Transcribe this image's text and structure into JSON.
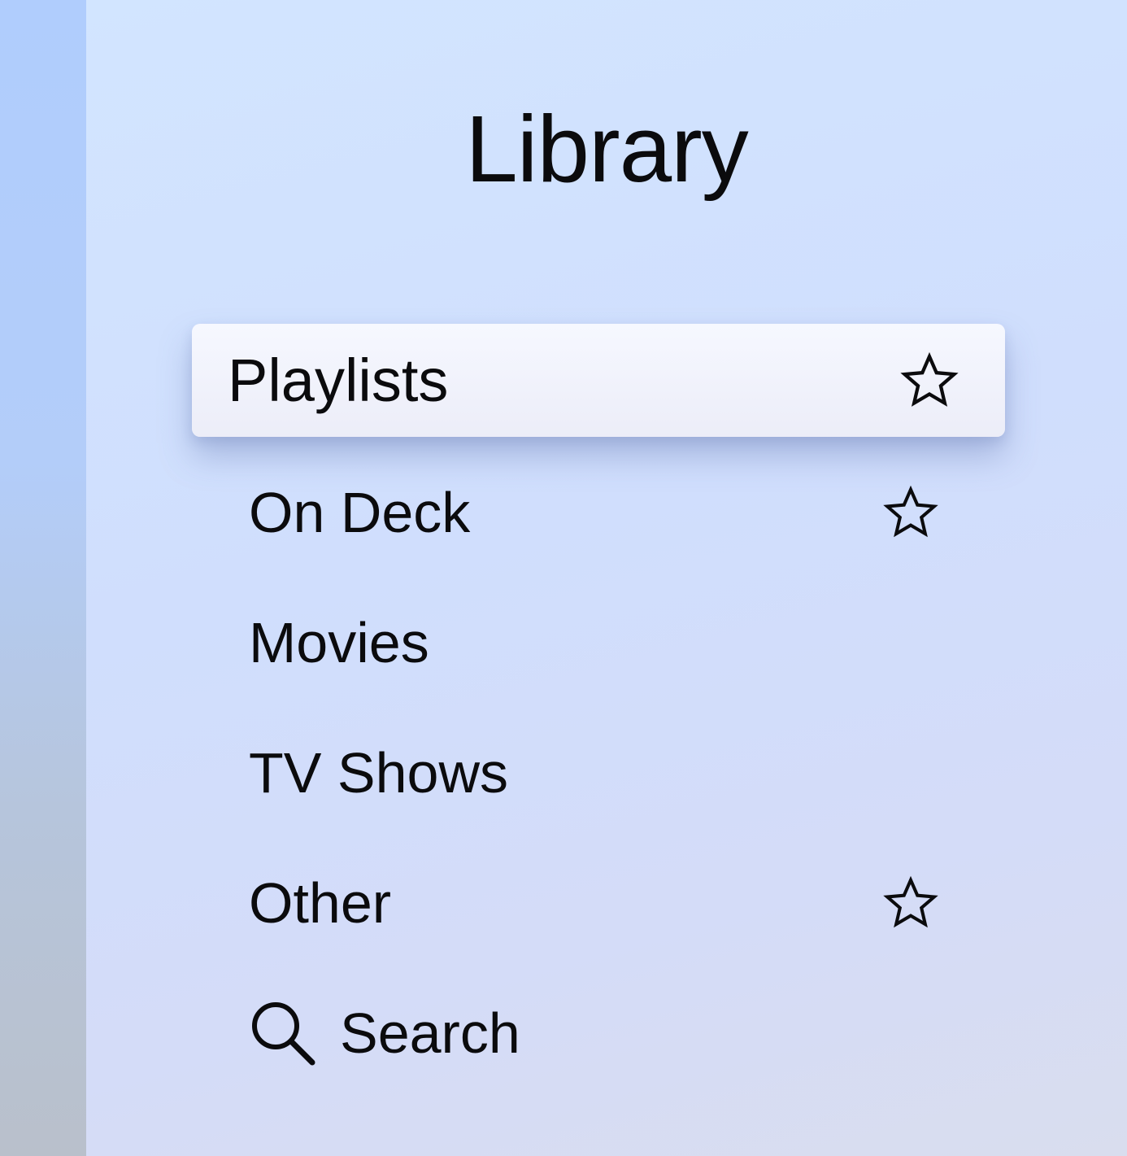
{
  "title": "Library",
  "menu": {
    "items": [
      {
        "label": "Playlists",
        "focused": true,
        "icon": "star-outline-icon"
      },
      {
        "label": "On Deck",
        "focused": false,
        "icon": "star-outline-icon"
      },
      {
        "label": "Movies",
        "focused": false
      },
      {
        "label": "TV Shows",
        "focused": false
      },
      {
        "label": "Other",
        "focused": false,
        "icon": "star-outline-icon"
      },
      {
        "label": "Search",
        "focused": false,
        "leading_icon": "search-icon"
      }
    ]
  },
  "colors": {
    "text": "#0b0b0d",
    "panel_background": "#d0defd",
    "focus_background": "#f2f4fd",
    "side_strip": "#b0cdfd"
  }
}
